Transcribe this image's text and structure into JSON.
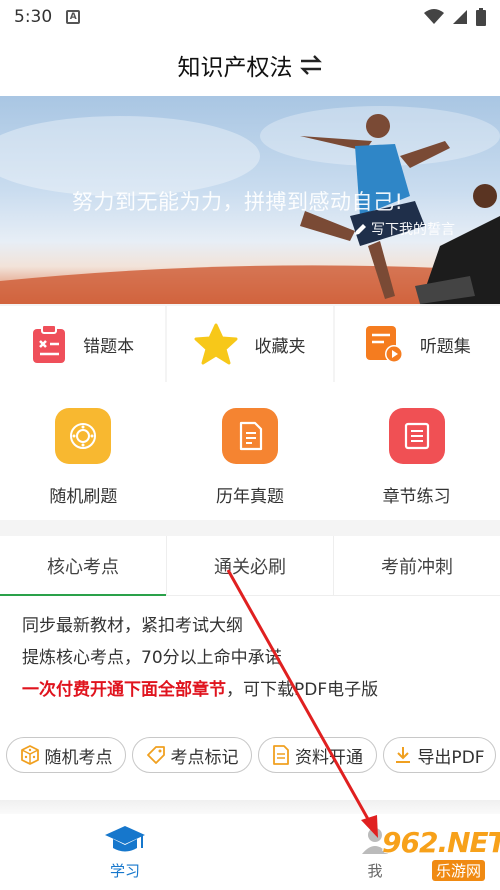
{
  "status_bar": {
    "time": "5:30",
    "badge": "A"
  },
  "header": {
    "title": "知识产权法"
  },
  "banner": {
    "slogan": "努力到无能为力，拼搏到感动自己!",
    "write_label": "写下我的誓言"
  },
  "quick_actions": [
    {
      "label": "错题本",
      "icon": "wrong-notebook-icon",
      "color": "#ef4f5a"
    },
    {
      "label": "收藏夹",
      "icon": "star-icon",
      "color": "#f7c819"
    },
    {
      "label": "听题集",
      "icon": "audio-book-icon",
      "color": "#f57c1f"
    }
  ],
  "features": [
    {
      "label": "随机刷题",
      "icon": "dice-icon",
      "color": "#f8b830"
    },
    {
      "label": "历年真题",
      "icon": "exam-paper-icon",
      "color": "#f58431"
    },
    {
      "label": "章节练习",
      "icon": "chapter-list-icon",
      "color": "#f05054"
    }
  ],
  "tabs": [
    {
      "label": "核心考点",
      "active": true
    },
    {
      "label": "通关必刷",
      "active": false
    },
    {
      "label": "考前冲刺",
      "active": false
    }
  ],
  "description": {
    "line1": "同步最新教材，紧扣考试大纲",
    "line2": "提炼核心考点，70分以上命中承诺",
    "line3_red": "一次付费开通下面全部章节",
    "line3_rest": "，可下载PDF电子版"
  },
  "chips": [
    {
      "label": "随机考点",
      "icon": "dice-small-icon",
      "color": "#f0a020"
    },
    {
      "label": "考点标记",
      "icon": "tag-icon",
      "color": "#f0a020"
    },
    {
      "label": "资料开通",
      "icon": "document-icon",
      "color": "#f0a020"
    },
    {
      "label": "导出PDF",
      "icon": "download-icon",
      "color": "#f0a020"
    }
  ],
  "bottom_nav": [
    {
      "label": "学习",
      "icon": "graduation-cap-icon",
      "active": true
    },
    {
      "label": "我",
      "icon": "user-icon",
      "active": false
    }
  ],
  "watermark": {
    "site": "962.NET",
    "cn": "乐游网"
  },
  "colors": {
    "accent_green": "#2aa14a",
    "nav_blue": "#1677cc",
    "highlight_red": "#e0141e",
    "annotation_arrow": "#e02020"
  }
}
